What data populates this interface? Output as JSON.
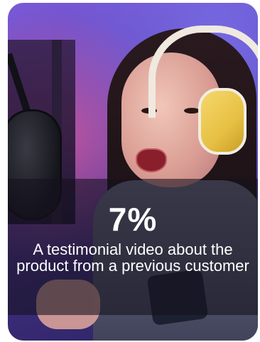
{
  "card": {
    "stat": "7%",
    "caption": "A testimonial video about the product from a previous customer"
  },
  "colors": {
    "background_purple": "#5a3fb8",
    "overlay": "#14121e",
    "text": "#ffffff",
    "headphones_yellow": "#e7c044"
  },
  "image": {
    "subject": "woman-with-yellow-headphones-at-microphone"
  }
}
